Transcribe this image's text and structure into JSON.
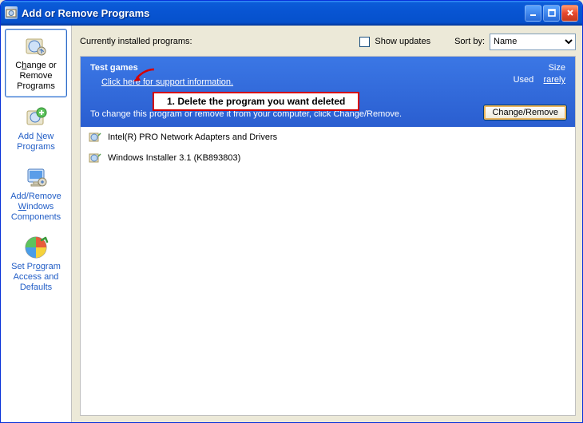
{
  "window": {
    "title": "Add or Remove Programs"
  },
  "sidebar": {
    "items": [
      {
        "label_html": "C<u>h</u>ange or Remove Programs"
      },
      {
        "label_html": "Add <u>N</u>ew Programs"
      },
      {
        "label_html": "Add/Remove <u>W</u>indows Components"
      },
      {
        "label_html": "Set Pr<u>o</u>gram Access and Defaults"
      }
    ]
  },
  "toolbar": {
    "current_label": "Currently installed programs:",
    "show_updates": "Show updates",
    "sort_by": "Sort by:",
    "sort_value": "Name"
  },
  "selected": {
    "name": "Test games",
    "support_link": "Click here for support information.",
    "size_label": "Size",
    "used_label": "Used",
    "used_value": "rarely",
    "description": "To change this program or remove it from your computer, click Change/Remove.",
    "button": "Change/Remove"
  },
  "annotation": "1. Delete the program you want deleted",
  "programs": [
    {
      "name": "Intel(R) PRO Network Adapters and Drivers"
    },
    {
      "name": "Windows Installer 3.1 (KB893803)"
    }
  ]
}
